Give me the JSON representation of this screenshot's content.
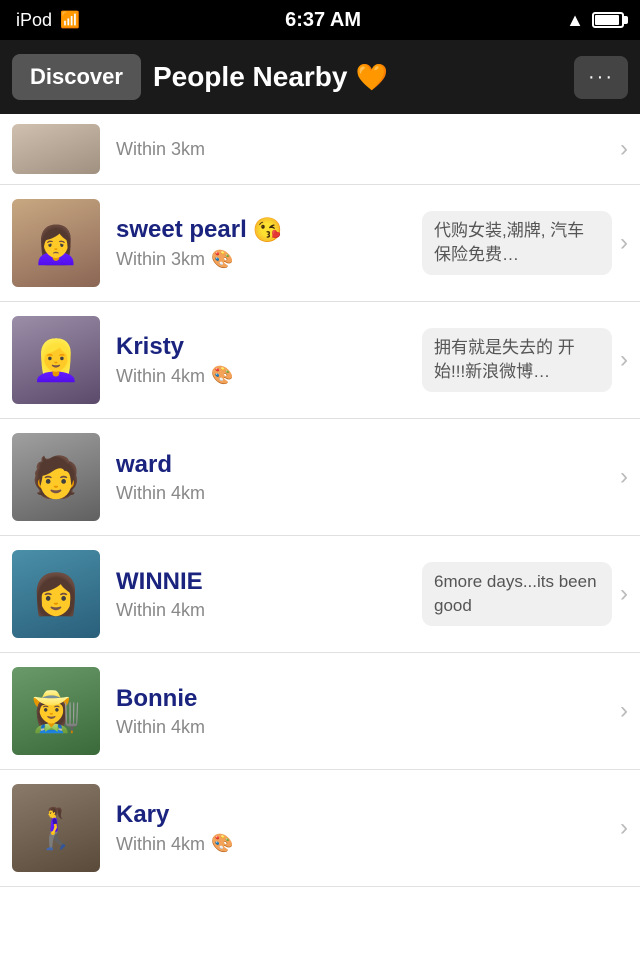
{
  "status_bar": {
    "device": "iPod",
    "time": "6:37 AM",
    "location_icon": "▶",
    "battery_icon": "battery"
  },
  "nav": {
    "discover_label": "Discover",
    "title": "People Nearby",
    "title_emoji": "🧡",
    "more_icon": "···"
  },
  "partial_item": {
    "distance": "Within 3km"
  },
  "people": [
    {
      "name": "sweet pearl",
      "name_emoji": "😘",
      "distance": "Within 3km",
      "has_pinwheel": true,
      "status": "代购女装,潮牌,\n汽车保险免费…",
      "avatar_class": "avatar-sweetpearl"
    },
    {
      "name": "Kristy",
      "name_emoji": "",
      "distance": "Within 4km",
      "has_pinwheel": true,
      "status": "拥有就是失去的\n开始!!!新浪微博…",
      "avatar_class": "avatar-kristy"
    },
    {
      "name": "ward",
      "name_emoji": "",
      "distance": "Within 4km",
      "has_pinwheel": false,
      "status": "",
      "avatar_class": "avatar-ward"
    },
    {
      "name": "WINNIE",
      "name_emoji": "",
      "distance": "Within 4km",
      "has_pinwheel": false,
      "status": "6more days...its\nbeen good",
      "avatar_class": "avatar-winnie"
    },
    {
      "name": "Bonnie",
      "name_emoji": "",
      "distance": "Within 4km",
      "has_pinwheel": false,
      "status": "",
      "avatar_class": "avatar-bonnie"
    },
    {
      "name": "Kary",
      "name_emoji": "",
      "distance": "Within 4km",
      "has_pinwheel": true,
      "status": "",
      "avatar_class": "avatar-kary"
    }
  ]
}
